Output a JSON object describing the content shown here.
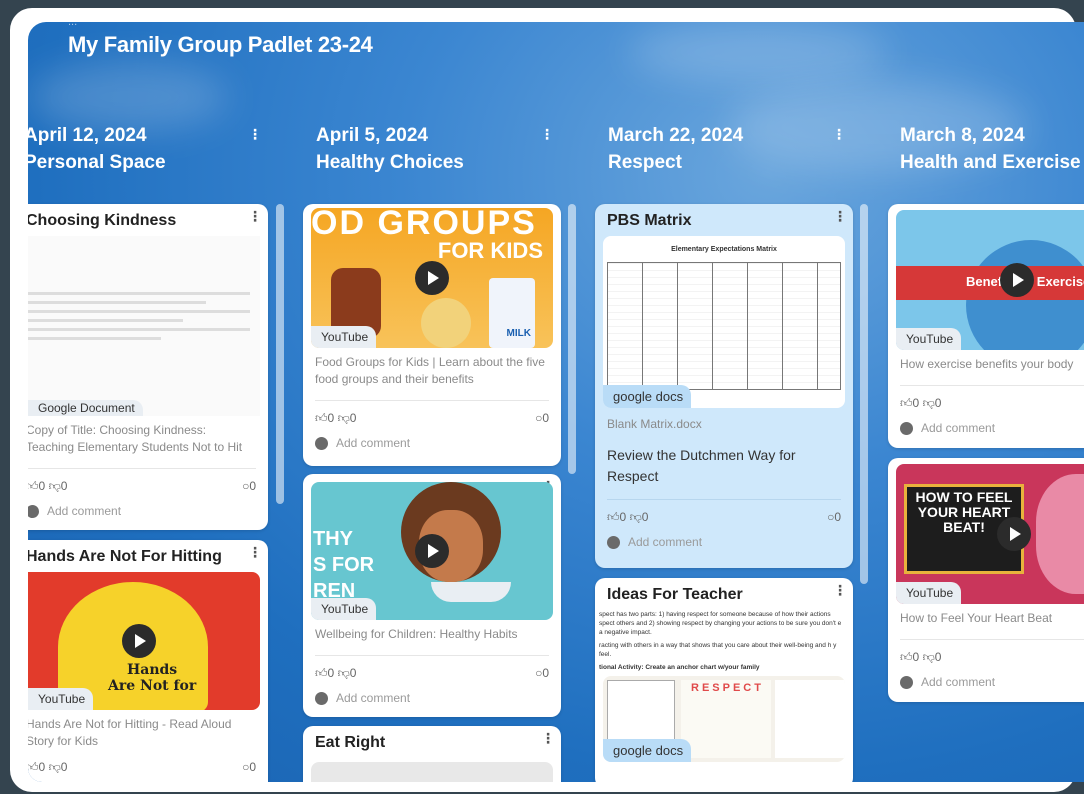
{
  "board": {
    "subtitle": "...",
    "title": "My Family Group Padlet 23-24"
  },
  "columns": [
    {
      "date": "April 12, 2024",
      "topic": "Personal Space"
    },
    {
      "date": "April 5, 2024",
      "topic": "Healthy Choices"
    },
    {
      "date": "March 22, 2024",
      "topic": "Respect"
    },
    {
      "date": "March 8, 2024",
      "topic": "Health and Exercise"
    }
  ],
  "cards": {
    "kindness": {
      "title": "Choosing Kindness",
      "tag": "Google Document",
      "desc": "Copy of Title: Choosing Kindness: Teaching Elementary Students Not to Hit",
      "likes": "0",
      "dislikes": "0",
      "comments": "0",
      "add": "Add comment"
    },
    "hands": {
      "title": "Hands Are Not For Hitting",
      "tag": "YouTube",
      "desc": "Hands Are Not for Hitting - Read Aloud Story for Kids",
      "likes": "0",
      "dislikes": "0",
      "comments": "0"
    },
    "foodgroups": {
      "tag": "YouTube",
      "desc": "Food Groups for Kids | Learn about the five food groups and their benefits",
      "likes": "0",
      "dislikes": "0",
      "comments": "0",
      "add": "Add comment",
      "thumb_text_1": "OD GROUPS",
      "thumb_text_2": "FOR KIDS",
      "thumb_text_3": "MILK"
    },
    "wellbeing": {
      "tag": "YouTube",
      "desc": "Wellbeing for Children: Healthy Habits",
      "likes": "0",
      "dislikes": "0",
      "comments": "0",
      "add": "Add comment",
      "thumb_text_1": "THY",
      "thumb_text_2": "S FOR",
      "thumb_text_3": "REN"
    },
    "eatright": {
      "title": "Eat Right"
    },
    "pbs": {
      "title": "PBS Matrix",
      "tag": "google docs",
      "doc_title": "Elementary Expectations Matrix",
      "file": "Blank Matrix.docx",
      "desc": "Review the Dutchmen Way for Respect",
      "likes": "0",
      "dislikes": "0",
      "comments": "0",
      "add": "Add comment"
    },
    "ideas": {
      "title": "Ideas For Teacher",
      "tag": "google docs",
      "body": "spect has two parts: 1) having respect for someone because of how their actions spect others and 2) showing respect by changing your actions to be sure you don't e a negative impact.",
      "body2": "racting with others in a way that shows that you care about their well-being and h y feel.",
      "body3": "tional Activity: Create an anchor chart w/your family",
      "chart_word": "RESPECT"
    },
    "exercise": {
      "tag": "YouTube",
      "desc": "How exercise benefits your body",
      "likes": "0",
      "dislikes": "0",
      "add": "Add comment",
      "thumb_text": "Benefits of Exercise"
    },
    "heart": {
      "tag": "YouTube",
      "desc": "How to Feel Your Heart Beat",
      "likes": "0",
      "dislikes": "0",
      "add": "Add comment",
      "thumb_text": "HOW TO FEEL YOUR HEART BEAT!"
    }
  },
  "colors": {
    "bg": "#1f6fbf",
    "card": "#ffffff",
    "card_blue": "#cfe8fb"
  }
}
